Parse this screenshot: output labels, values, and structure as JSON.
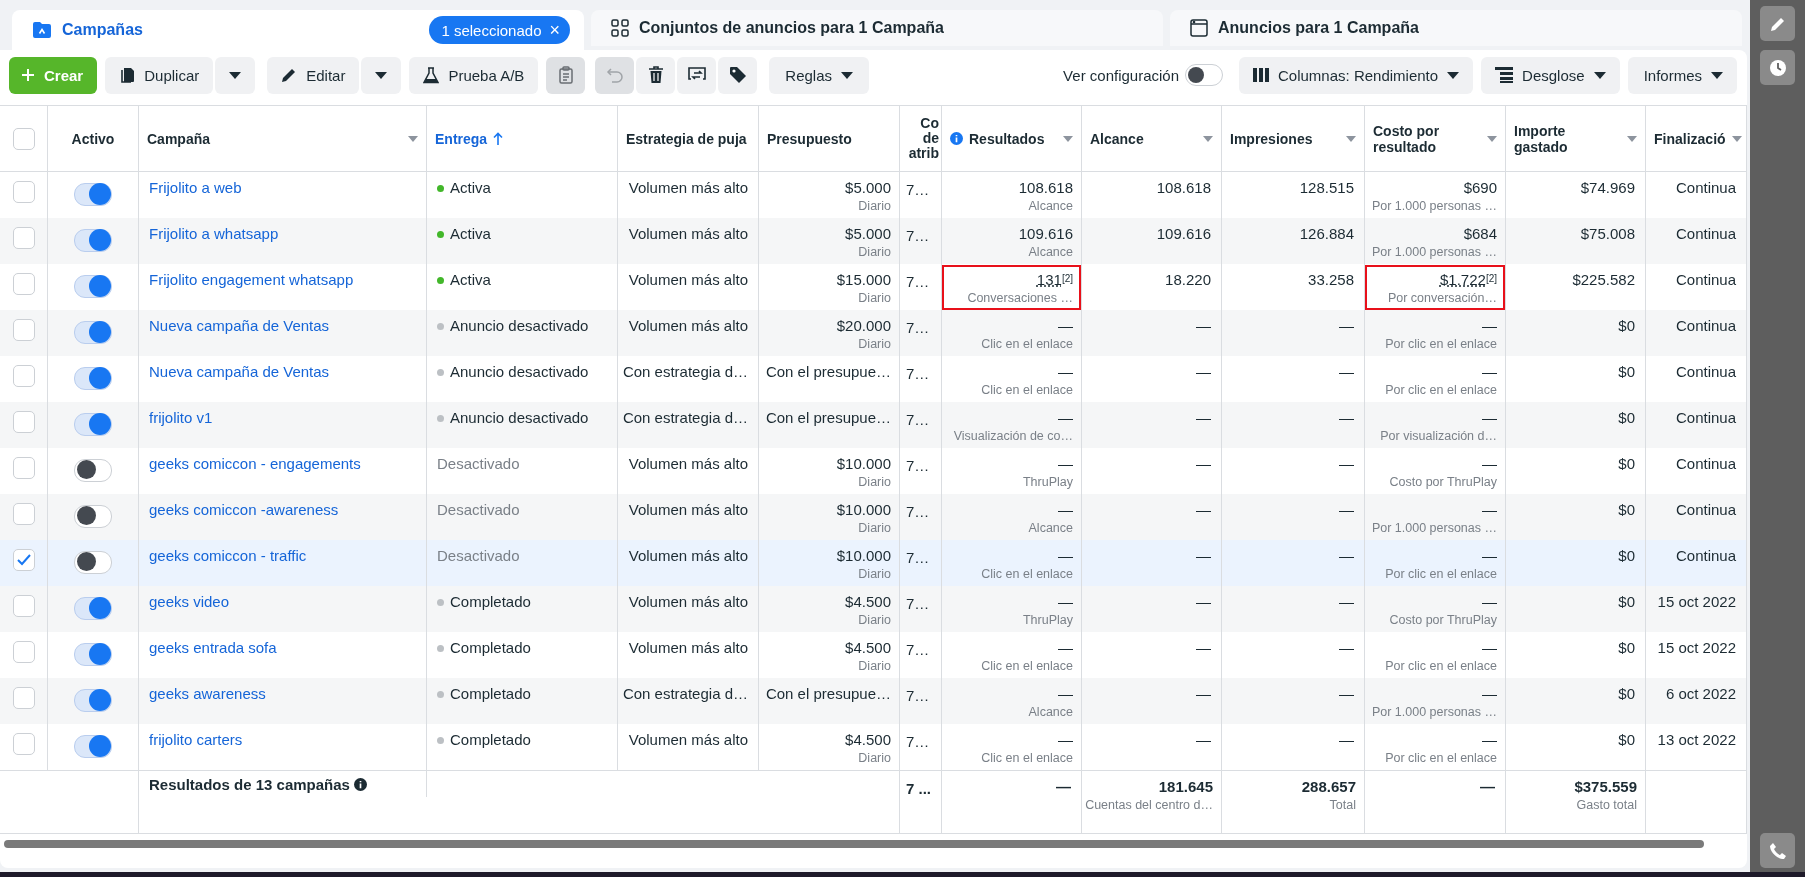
{
  "tabs": [
    {
      "kind": "campaigns",
      "label": "Campañas",
      "selected": true,
      "badge": "1 seleccionado",
      "badge_close": "×"
    },
    {
      "kind": "adsets",
      "label": "Conjuntos de anuncios para 1 Campaña",
      "selected": false
    },
    {
      "kind": "ads",
      "label": "Anuncios para 1 Campaña",
      "selected": false
    }
  ],
  "toolbar": {
    "create": "Crear",
    "duplicate": "Duplicar",
    "edit": "Editar",
    "ab_test": "Prueba A/B",
    "tools": [
      {
        "kind": "clipboard",
        "disabled": true
      },
      {
        "kind": "undo",
        "disabled": true
      },
      {
        "kind": "delete",
        "disabled": false
      },
      {
        "kind": "swap",
        "disabled": false
      },
      {
        "kind": "tag",
        "disabled": false
      }
    ],
    "rules": "Reglas",
    "view_settings": "Ver configuración",
    "view_settings_on": false,
    "columns": "Columnas: Rendimiento",
    "breakdown": "Desglose",
    "reports": "Informes"
  },
  "table": {
    "all_checked": false,
    "columns": [
      {
        "label": "Activo",
        "sortable": false,
        "sorted": false,
        "info": false
      },
      {
        "label": "Campaña",
        "sortable": true,
        "sorted": false,
        "info": false
      },
      {
        "label": "Entrega",
        "sortable": false,
        "sorted": true,
        "info": false
      },
      {
        "label": "Estrategia de puja",
        "sortable": false,
        "sorted": false,
        "info": false
      },
      {
        "label": "Presupuesto",
        "sortable": false,
        "sorted": false,
        "info": false
      },
      {
        "label": "Co de atrib",
        "sortable": false,
        "sorted": false,
        "info": false
      },
      {
        "label": "Resultados",
        "sortable": true,
        "sorted": false,
        "info": true
      },
      {
        "label": "Alcance",
        "sortable": true,
        "sorted": false,
        "info": false
      },
      {
        "label": "Impresiones",
        "sortable": true,
        "sorted": false,
        "info": false
      },
      {
        "label": "Costo por resultado",
        "sortable": true,
        "sorted": false,
        "info": false
      },
      {
        "label": "Importe gastado",
        "sortable": true,
        "sorted": false,
        "info": false
      },
      {
        "label": "Finalizació",
        "sortable": true,
        "sorted": false,
        "info": false
      }
    ],
    "rows": [
      {
        "checked": false,
        "active": true,
        "name": "Frijolito a web",
        "delivery": "Activa",
        "color": "#42b72a",
        "delivery_muted": false,
        "strategy": "Volumen más alto",
        "budget": "$5.000",
        "budget_period": "Diario",
        "attribution": "7…",
        "results": "108.618",
        "results_type": "Alcance",
        "reach": "108.618",
        "impressions": "128.515",
        "cost": "$690",
        "cost_type": "Por 1.000 personas …",
        "spent": "$74.969",
        "end": "Continua",
        "highlighted": false
      },
      {
        "checked": false,
        "active": true,
        "name": "Frijolito a whatsapp",
        "delivery": "Activa",
        "color": "#42b72a",
        "delivery_muted": false,
        "strategy": "Volumen más alto",
        "budget": "$5.000",
        "budget_period": "Diario",
        "attribution": "7…",
        "results": "109.616",
        "results_type": "Alcance",
        "reach": "109.616",
        "impressions": "126.884",
        "cost": "$684",
        "cost_type": "Por 1.000 personas …",
        "spent": "$75.008",
        "end": "Continua",
        "highlighted": false
      },
      {
        "checked": false,
        "active": true,
        "name": "Frijolito engagement whatsapp",
        "delivery": "Activa",
        "color": "#42b72a",
        "delivery_muted": false,
        "strategy": "Volumen más alto",
        "budget": "$15.000",
        "budget_period": "Diario",
        "attribution": "7…",
        "results": "131",
        "results_note": "[2]",
        "results_type": "Conversaciones …",
        "reach": "18.220",
        "impressions": "33.258",
        "cost": "$1.722",
        "cost_note": "[2]",
        "cost_type": "Por conversación…",
        "spent": "$225.582",
        "end": "Continua",
        "highlighted": true
      },
      {
        "checked": false,
        "active": true,
        "name": "Nueva campaña de Ventas",
        "delivery": "Anuncio desactivado",
        "color": "#bcc0c4",
        "delivery_muted": false,
        "strategy": "Volumen más alto",
        "budget": "$20.000",
        "budget_period": "Diario",
        "attribution": "7…",
        "results": "—",
        "results_type": "Clic en el enlace",
        "reach": "—",
        "impressions": "—",
        "cost": "—",
        "cost_type": "Por clic en el enlace",
        "spent": "$0",
        "end": "Continua",
        "highlighted": false
      },
      {
        "checked": false,
        "active": true,
        "name": "Nueva campaña de Ventas",
        "delivery": "Anuncio desactivado",
        "color": "#bcc0c4",
        "delivery_muted": false,
        "strategy": "Con estrategia d…",
        "budget": "Con el presupue…",
        "attribution": "7…",
        "results": "—",
        "results_type": "Clic en el enlace",
        "reach": "—",
        "impressions": "—",
        "cost": "—",
        "cost_type": "Por clic en el enlace",
        "spent": "$0",
        "end": "Continua",
        "highlighted": false
      },
      {
        "checked": false,
        "active": true,
        "name": "frijolito v1",
        "delivery": "Anuncio desactivado",
        "color": "#bcc0c4",
        "delivery_muted": false,
        "strategy": "Con estrategia d…",
        "budget": "Con el presupue…",
        "attribution": "7…",
        "results": "—",
        "results_type": "Visualización de co…",
        "reach": "—",
        "impressions": "—",
        "cost": "—",
        "cost_type": "Por visualización d…",
        "spent": "$0",
        "end": "Continua",
        "highlighted": false
      },
      {
        "checked": false,
        "active": false,
        "name": "geeks comiccon - engagements",
        "delivery": "Desactivado",
        "delivery_muted": true,
        "strategy": "Volumen más alto",
        "budget": "$10.000",
        "budget_period": "Diario",
        "attribution": "7…",
        "results": "—",
        "results_type": "ThruPlay",
        "reach": "—",
        "impressions": "—",
        "cost": "—",
        "cost_type": "Costo por ThruPlay",
        "spent": "$0",
        "end": "Continua",
        "highlighted": false
      },
      {
        "checked": false,
        "active": false,
        "name": "geeks comiccon -awareness",
        "delivery": "Desactivado",
        "delivery_muted": true,
        "strategy": "Volumen más alto",
        "budget": "$10.000",
        "budget_period": "Diario",
        "attribution": "7…",
        "results": "—",
        "results_type": "Alcance",
        "reach": "—",
        "impressions": "—",
        "cost": "—",
        "cost_type": "Por 1.000 personas …",
        "spent": "$0",
        "end": "Continua",
        "highlighted": false
      },
      {
        "checked": true,
        "active": false,
        "name": "geeks comiccon - traffic",
        "delivery": "Desactivado",
        "delivery_muted": true,
        "strategy": "Volumen más alto",
        "budget": "$10.000",
        "budget_period": "Diario",
        "attribution": "7…",
        "results": "—",
        "results_type": "Clic en el enlace",
        "reach": "—",
        "impressions": "—",
        "cost": "—",
        "cost_type": "Por clic en el enlace",
        "spent": "$0",
        "end": "Continua",
        "highlighted": false
      },
      {
        "checked": false,
        "active": true,
        "name": "geeks video",
        "delivery": "Completado",
        "color": "#bcc0c4",
        "delivery_muted": false,
        "strategy": "Volumen más alto",
        "budget": "$4.500",
        "budget_period": "Diario",
        "attribution": "7…",
        "results": "—",
        "results_type": "ThruPlay",
        "reach": "—",
        "impressions": "—",
        "cost": "—",
        "cost_type": "Costo por ThruPlay",
        "spent": "$0",
        "end": "15 oct 2022",
        "highlighted": false
      },
      {
        "checked": false,
        "active": true,
        "name": "geeks entrada sofa",
        "delivery": "Completado",
        "color": "#bcc0c4",
        "delivery_muted": false,
        "strategy": "Volumen más alto",
        "budget": "$4.500",
        "budget_period": "Diario",
        "attribution": "7…",
        "results": "—",
        "results_type": "Clic en el enlace",
        "reach": "—",
        "impressions": "—",
        "cost": "—",
        "cost_type": "Por clic en el enlace",
        "spent": "$0",
        "end": "15 oct 2022",
        "highlighted": false
      },
      {
        "checked": false,
        "active": true,
        "name": "geeks awareness",
        "delivery": "Completado",
        "color": "#bcc0c4",
        "delivery_muted": false,
        "strategy": "Con estrategia d…",
        "budget": "Con el presupue…",
        "attribution": "7…",
        "results": "—",
        "results_type": "Alcance",
        "reach": "—",
        "impressions": "—",
        "cost": "—",
        "cost_type": "Por 1.000 personas …",
        "spent": "$0",
        "end": "6 oct 2022",
        "highlighted": false
      },
      {
        "checked": false,
        "active": true,
        "name": "frijolito carters",
        "delivery": "Completado",
        "color": "#bcc0c4",
        "delivery_muted": false,
        "strategy": "Volumen más alto",
        "budget": "$4.500",
        "budget_period": "Diario",
        "attribution": "7…",
        "results": "—",
        "results_type": "Clic en el enlace",
        "reach": "—",
        "impressions": "—",
        "cost": "—",
        "cost_type": "Por clic en el enlace",
        "spent": "$0",
        "end": "13 oct 2022",
        "highlighted": false
      }
    ],
    "footer": {
      "label": "Resultados de 13 campañas",
      "attribution": "7 ...",
      "results": "—",
      "reach": "181.645",
      "reach_type": "Cuentas del centro d…",
      "impressions": "288.657",
      "impressions_type": "Total",
      "cost": "—",
      "spent": "$375.559",
      "spent_type": "Gasto total"
    }
  }
}
